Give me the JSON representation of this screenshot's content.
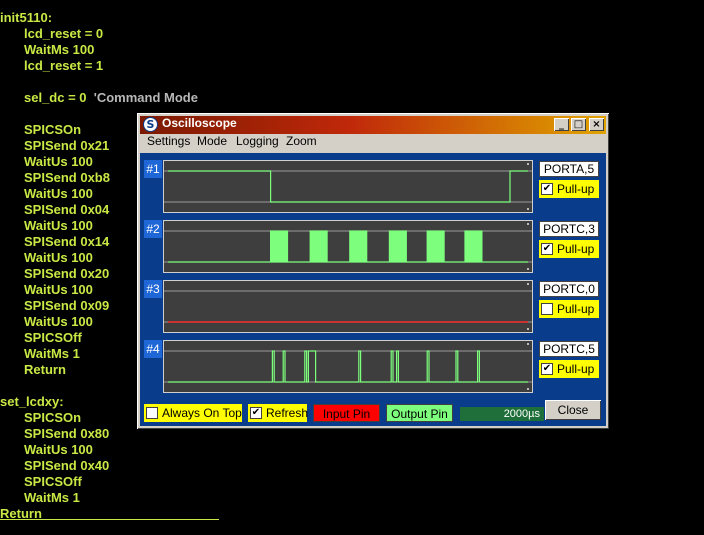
{
  "code_lines": [
    {
      "text": "init5110:",
      "type": "kw",
      "indent": false
    },
    {
      "text": "lcd_reset = 0",
      "type": "kw",
      "indent": true
    },
    {
      "text": "WaitMs 100",
      "type": "kw",
      "indent": true
    },
    {
      "text": "lcd_reset = 1",
      "type": "kw",
      "indent": true
    },
    {
      "text": "",
      "type": "kw",
      "indent": false
    },
    {
      "text": "sel_dc = 0",
      "type": "kw",
      "indent": true,
      "comment": "'Command Mode"
    },
    {
      "text": "",
      "type": "kw",
      "indent": false
    },
    {
      "text": "SPICSOn",
      "type": "kw",
      "indent": true
    },
    {
      "text": "SPISend 0x21",
      "type": "kw",
      "indent": true
    },
    {
      "text": "WaitUs 100",
      "type": "kw",
      "indent": true
    },
    {
      "text": "SPISend 0xb8",
      "type": "kw",
      "indent": true
    },
    {
      "text": "WaitUs 100",
      "type": "kw",
      "indent": true
    },
    {
      "text": "SPISend 0x04",
      "type": "kw",
      "indent": true
    },
    {
      "text": "WaitUs 100",
      "type": "kw",
      "indent": true
    },
    {
      "text": "SPISend 0x14",
      "type": "kw",
      "indent": true
    },
    {
      "text": "WaitUs 100",
      "type": "kw",
      "indent": true
    },
    {
      "text": "SPISend 0x20",
      "type": "kw",
      "indent": true
    },
    {
      "text": "WaitUs 100",
      "type": "kw",
      "indent": true
    },
    {
      "text": "SPISend 0x09",
      "type": "kw",
      "indent": true
    },
    {
      "text": "WaitUs 100",
      "type": "kw",
      "indent": true
    },
    {
      "text": "SPICSOff",
      "type": "kw",
      "indent": true
    },
    {
      "text": "WaitMs 1",
      "type": "kw",
      "indent": true
    },
    {
      "text": "Return",
      "type": "kw",
      "indent": true
    },
    {
      "text": "",
      "type": "kw",
      "indent": false
    },
    {
      "text": "set_lcdxy:",
      "type": "kw",
      "indent": false
    },
    {
      "text": "SPICSOn",
      "type": "kw",
      "indent": true
    },
    {
      "text": "SPISend 0x80",
      "type": "kw",
      "indent": true
    },
    {
      "text": "WaitUs 100",
      "type": "kw",
      "indent": true
    },
    {
      "text": "SPISend 0x40",
      "type": "kw",
      "indent": true
    },
    {
      "text": "SPICSOff",
      "type": "kw",
      "indent": true
    },
    {
      "text": "WaitMs 1",
      "type": "kw",
      "indent": true
    },
    {
      "text": "Return",
      "type": "kw",
      "indent": false
    }
  ],
  "window": {
    "title": "Oscilloscope",
    "minimize": "_",
    "maximize": "□",
    "close": "×"
  },
  "menu": [
    "Settings",
    "Mode",
    "Logging",
    "Zoom"
  ],
  "channels": [
    {
      "tag": "#1",
      "port": "PORTA,5",
      "pullup_label": "Pull-up",
      "pullup_checked": true,
      "trace_color": "#7dff7d",
      "signal": [
        [
          0,
          1
        ],
        [
          0.285,
          1
        ],
        [
          0.285,
          0
        ],
        [
          0.95,
          0
        ],
        [
          0.95,
          1
        ],
        [
          1,
          1
        ]
      ]
    },
    {
      "tag": "#2",
      "port": "PORTC,3",
      "pullup_label": "Pull-up",
      "pullup_checked": true,
      "trace_color": "#7dff7d",
      "bursts": [
        0.285,
        0.395,
        0.505,
        0.615,
        0.72,
        0.825
      ],
      "burst_width": 0.05,
      "burst_pulses": 8
    },
    {
      "tag": "#3",
      "port": "PORTC,0",
      "pullup_label": "Pull-up",
      "pullup_checked": false,
      "trace_color": "#c83232",
      "signal": [
        [
          0,
          0
        ],
        [
          1,
          0
        ]
      ]
    },
    {
      "tag": "#4",
      "port": "PORTC,5",
      "pullup_label": "Pull-up",
      "pullup_checked": true,
      "trace_color": "#7dff7d",
      "signal": [
        [
          0,
          0
        ],
        [
          0.29,
          0
        ],
        [
          0.29,
          1
        ],
        [
          0.295,
          1
        ],
        [
          0.295,
          0
        ],
        [
          0.32,
          0
        ],
        [
          0.32,
          1
        ],
        [
          0.325,
          1
        ],
        [
          0.325,
          0
        ],
        [
          0.38,
          0
        ],
        [
          0.38,
          1
        ],
        [
          0.385,
          1
        ],
        [
          0.385,
          0
        ],
        [
          0.39,
          0
        ],
        [
          0.39,
          1
        ],
        [
          0.41,
          1
        ],
        [
          0.41,
          0
        ],
        [
          0.53,
          0
        ],
        [
          0.53,
          1
        ],
        [
          0.535,
          1
        ],
        [
          0.535,
          0
        ],
        [
          0.62,
          0
        ],
        [
          0.62,
          1
        ],
        [
          0.625,
          1
        ],
        [
          0.625,
          0
        ],
        [
          0.635,
          0
        ],
        [
          0.635,
          1
        ],
        [
          0.64,
          1
        ],
        [
          0.64,
          0
        ],
        [
          0.72,
          0
        ],
        [
          0.72,
          1
        ],
        [
          0.725,
          1
        ],
        [
          0.725,
          0
        ],
        [
          0.8,
          0
        ],
        [
          0.8,
          1
        ],
        [
          0.805,
          1
        ],
        [
          0.805,
          0
        ],
        [
          0.86,
          0
        ],
        [
          0.86,
          1
        ],
        [
          0.865,
          1
        ],
        [
          0.865,
          0
        ],
        [
          1,
          0
        ]
      ]
    }
  ],
  "bottom": {
    "always_on_top": "Always On Top",
    "always_on_top_checked": false,
    "refresh": "Refresh",
    "refresh_checked": true,
    "input_pin": "Input Pin",
    "output_pin": "Output Pin",
    "timebase": "2000µs",
    "close": "Close"
  },
  "colors": {
    "code_text": "#c8e845",
    "panel_bg": "#0a3c8c",
    "input_pin_bg": "#ff0000",
    "output_pin_bg": "#7dff7d",
    "pullup_bg": "#ffff00"
  }
}
